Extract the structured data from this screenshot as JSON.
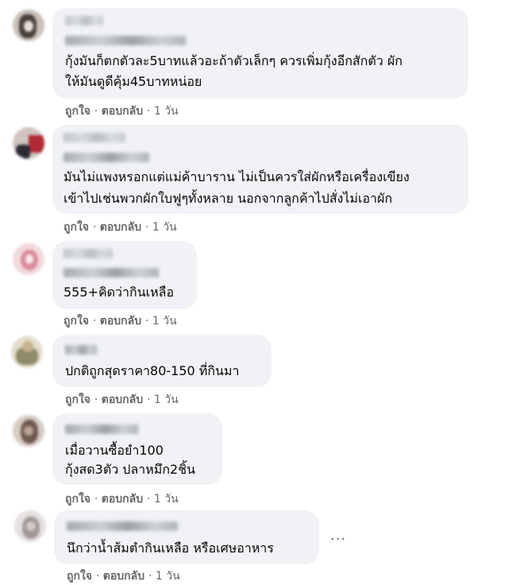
{
  "comments": [
    {
      "lines": [
        "กุ้งมันก็ตกตัวละ5บาทแล้วอะถ้าตัวเล็กๆ ควรเพิ่มกุ้งอีกสักตัว ผัก",
        "ให้มันดูดีคุ้ม45บาทหน่อย"
      ],
      "like": "ถูกใจ",
      "reply": "ตอบกลับ",
      "time": "1 วัน",
      "avatar_colors": [
        "#c9c2bb",
        "#4a3f3a",
        "#e7ddd4"
      ]
    },
    {
      "lines": [
        "มันไม่แพงหรอกแต่แม่ค้าบาราน ไม่เป็นควรใส่ผักหรือเครื่องเขียง",
        "เข้าไปเช่นพวกผักใบฟูๆทั้งหลาย นอกจากลูกค้าไปสั่งไม่เอาผัก"
      ],
      "like": "ถูกใจ",
      "reply": "ตอบกลับ",
      "time": "1 วัน",
      "avatar_colors": [
        "#d0c6bf",
        "#b02a32",
        "#2b2b33"
      ]
    },
    {
      "lines": [
        "555+คิดว่ากินเหลือ"
      ],
      "like": "ถูกใจ",
      "reply": "ตอบกลับ",
      "time": "1 วัน",
      "avatar_colors": [
        "#f1d9dc",
        "#d98b98",
        "#f6e7e9"
      ]
    },
    {
      "lines": [
        "ปกติถูกสุดราคา80-150 ที่กินมา"
      ],
      "like": "ถูกใจ",
      "reply": "ตอบกลับ",
      "time": "1 วัน",
      "avatar_colors": [
        "#e3dccb",
        "#8e8a6a",
        "#c7b48f"
      ]
    },
    {
      "lines": [
        "เมื่อวานซื้อยำ100",
        "กุ้งสด3ตัว ปลาหมึก2ชิ้น"
      ],
      "like": "ถูกใจ",
      "reply": "ตอบกลับ",
      "time": "1 วัน",
      "avatar_colors": [
        "#d6ccc4",
        "#6e5a50",
        "#b8a396"
      ]
    },
    {
      "lines": [
        "นึกว่าน้ำส้มตำกินเหลือ หรือเศษอาหาร"
      ],
      "like": "ถูกใจ",
      "reply": "ตอบกลับ",
      "time": "1 วัน",
      "avatar_colors": [
        "#e6e1e1",
        "#a39696",
        "#d2c9c9"
      ]
    }
  ],
  "more_options": "···",
  "separator": "·"
}
